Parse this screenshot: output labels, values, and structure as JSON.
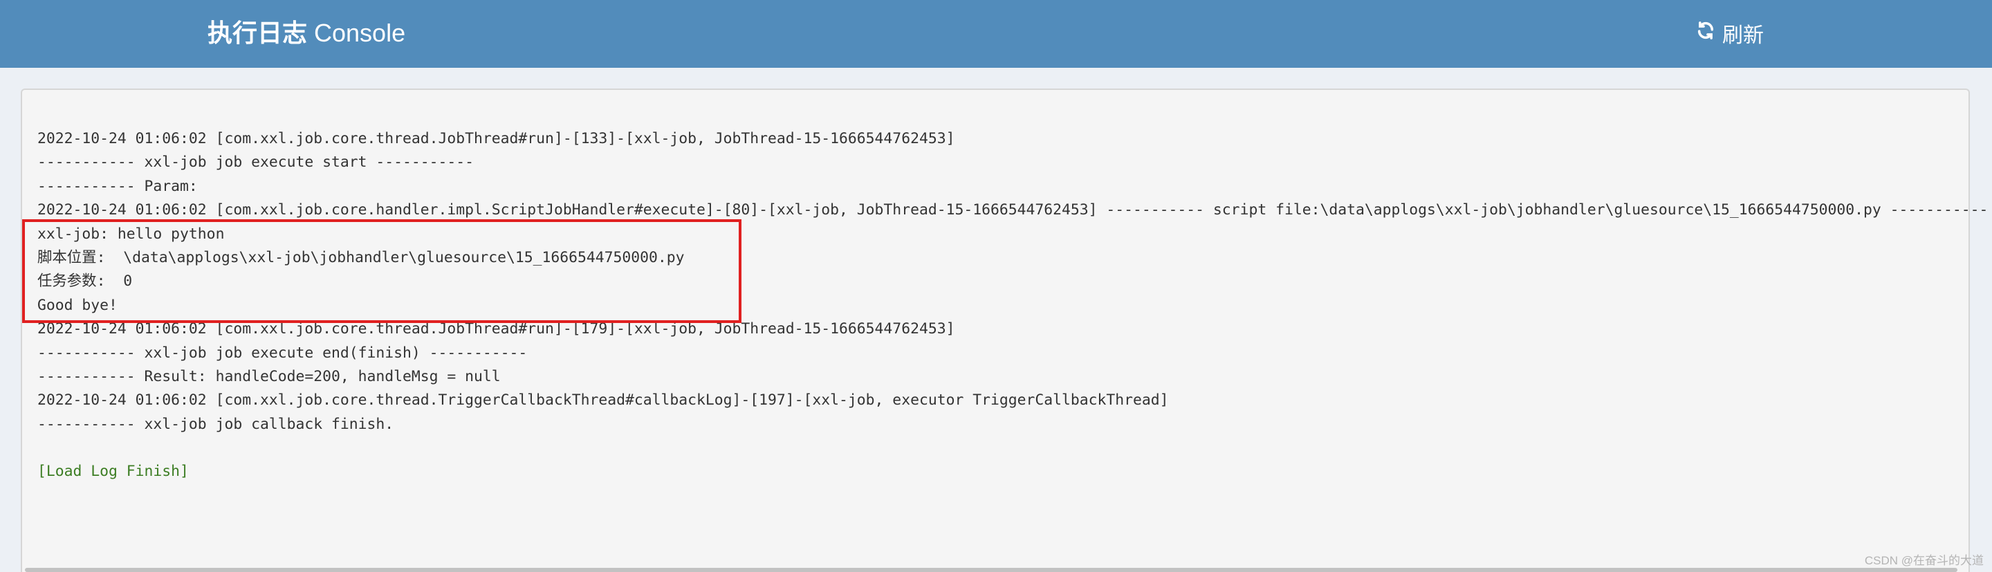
{
  "header": {
    "title_bold": "执行日志",
    "title_sub": "Console",
    "refresh_label": "刷新",
    "refresh_icon": "refresh-icon"
  },
  "log_lines": [
    "2022-10-24 01:06:02 [com.xxl.job.core.thread.JobThread#run]-[133]-[xxl-job, JobThread-15-1666544762453]",
    "----------- xxl-job job execute start -----------",
    "----------- Param:",
    "2022-10-24 01:06:02 [com.xxl.job.core.handler.impl.ScriptJobHandler#execute]-[80]-[xxl-job, JobThread-15-1666544762453] ----------- script file:\\data\\applogs\\xxl-job\\jobhandler\\gluesource\\15_1666544750000.py -----------",
    "xxl-job: hello python",
    "脚本位置:  \\data\\applogs\\xxl-job\\jobhandler\\gluesource\\15_1666544750000.py",
    "任务参数:  0",
    "Good bye!",
    "2022-10-24 01:06:02 [com.xxl.job.core.thread.JobThread#run]-[179]-[xxl-job, JobThread-15-1666544762453]",
    "----------- xxl-job job execute end(finish) -----------",
    "----------- Result: handleCode=200, handleMsg = null",
    "2022-10-24 01:06:02 [com.xxl.job.core.thread.TriggerCallbackThread#callbackLog]-[197]-[xxl-job, executor TriggerCallbackThread]",
    "----------- xxl-job job callback finish.",
    "",
    "[Load Log Finish]"
  ],
  "colors": {
    "header_bg": "#528cbb",
    "finish_text": "#3c7d23",
    "highlight_border": "#e02020"
  },
  "watermark": "CSDN @在奋斗的大道"
}
